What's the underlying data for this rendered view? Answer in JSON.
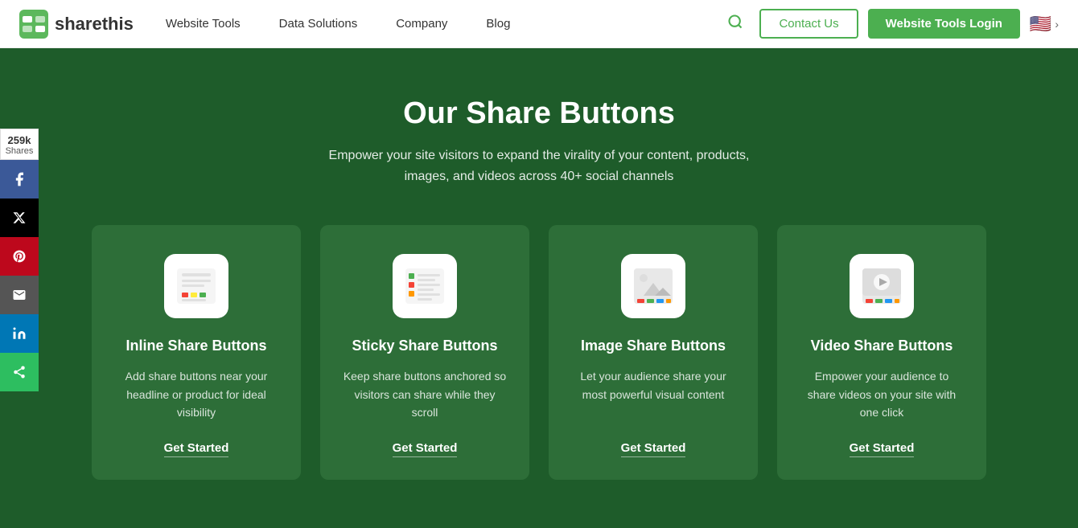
{
  "nav": {
    "logo_text": "sharethis",
    "links": [
      {
        "label": "Website Tools",
        "id": "website-tools"
      },
      {
        "label": "Data Solutions",
        "id": "data-solutions"
      },
      {
        "label": "Company",
        "id": "company"
      },
      {
        "label": "Blog",
        "id": "blog"
      }
    ],
    "contact_label": "Contact Us",
    "login_label": "Website Tools Login"
  },
  "hero": {
    "title": "Our Share Buttons",
    "subtitle": "Empower your site visitors to expand the virality of your content, products, images, and videos across 40+ social channels"
  },
  "cards": [
    {
      "id": "inline",
      "title": "Inline Share Buttons",
      "desc": "Add share buttons near your headline or product for ideal visibility",
      "cta": "Get Started"
    },
    {
      "id": "sticky",
      "title": "Sticky Share Buttons",
      "desc": "Keep share buttons anchored so visitors can share while they scroll",
      "cta": "Get Started"
    },
    {
      "id": "image",
      "title": "Image Share Buttons",
      "desc": "Let your audience share your most powerful visual content",
      "cta": "Get Started"
    },
    {
      "id": "video",
      "title": "Video Share Buttons",
      "desc": "Empower your audience to share videos on your site with one click",
      "cta": "Get Started"
    }
  ],
  "sidebar": {
    "count": "259k",
    "shares_label": "Shares",
    "buttons": [
      {
        "id": "facebook",
        "label": "f",
        "class": "fb"
      },
      {
        "id": "twitter",
        "label": "𝕏",
        "class": "tw"
      },
      {
        "id": "pinterest",
        "label": "P",
        "class": "pt"
      },
      {
        "id": "email",
        "label": "✉",
        "class": "em"
      },
      {
        "id": "linkedin",
        "label": "in",
        "class": "li"
      },
      {
        "id": "share",
        "label": "⬆",
        "class": "sh"
      }
    ]
  }
}
